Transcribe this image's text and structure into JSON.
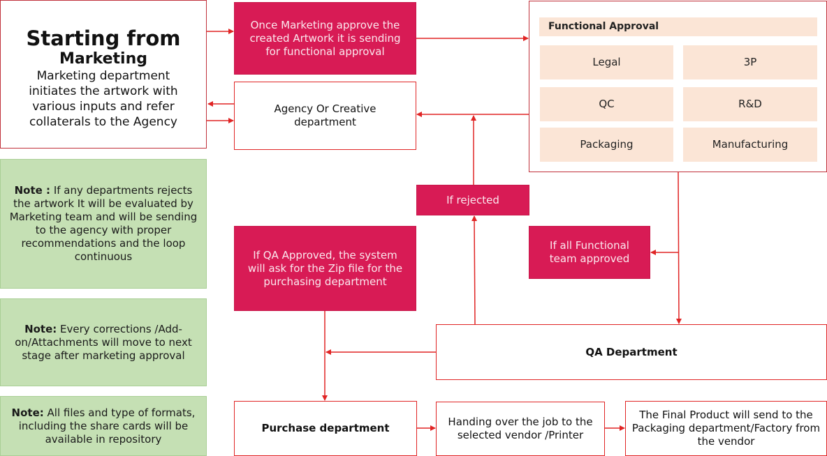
{
  "start": {
    "title_line1": "Starting from",
    "title_line2": "Marketing",
    "description": "Marketing department initiates the artwork with various inputs and refer collaterals  to the Agency"
  },
  "marketing_approve": "Once Marketing  approve the created Artwork it is sending for functional approval",
  "agency": "Agency Or Creative department",
  "functional_approval": {
    "title": "Functional Approval",
    "departments": [
      "Legal",
      "3P",
      "QC",
      "R&D",
      "Packaging",
      "Manufacturing"
    ]
  },
  "notes": [
    {
      "label": "Note :",
      "text": " If  any departments rejects the artwork  It will be evaluated by Marketing team and will be sending to the agency with proper  recommendations and the loop continuous"
    },
    {
      "label": "Note:",
      "text": " Every corrections /Add-on/Attachments  will move to next stage after marketing approval"
    },
    {
      "label": "Note:",
      "text": " All files and type of formats, including the share cards will be available in repository"
    }
  ],
  "if_rejected": "If rejected",
  "qa_approved": "If  QA Approved, the  system will ask for the Zip  file for the purchasing  department",
  "all_functional": "If all Functional team approved",
  "qa_department": "QA Department",
  "purchase": "Purchase department",
  "handing_over": "Handing over the job to the selected  vendor /Printer",
  "final_product": "The Final Product  will send to the Packaging department/Factory from the  vendor",
  "colors": {
    "accent": "#d81b55",
    "line": "#e02424",
    "note_green": "#c5e0b4",
    "peach": "#fbe5d6"
  }
}
